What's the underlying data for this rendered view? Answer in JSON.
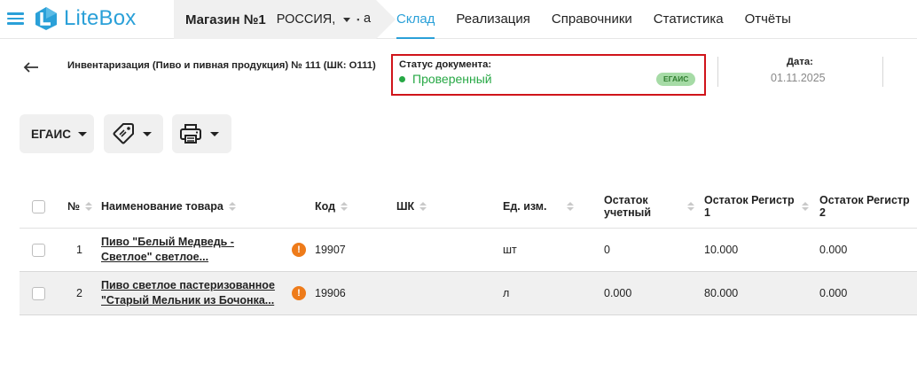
{
  "header": {
    "logo_text": "LiteBox",
    "store_name": "Магазин №1",
    "store_country": "РОССИЯ,",
    "store_tail": "а",
    "nav": [
      {
        "label": "Склад",
        "active": true
      },
      {
        "label": "Реализация",
        "active": false
      },
      {
        "label": "Справочники",
        "active": false
      },
      {
        "label": "Статистика",
        "active": false
      },
      {
        "label": "Отчёты",
        "active": false
      }
    ],
    "accent_color": "#2aa0d8"
  },
  "document": {
    "title": "Инвентаризация (Пиво и пивная продукция) № 111 (ШК: О111)",
    "status_label": "Статус документа:",
    "status_value": "Проверенный",
    "status_color": "#27a845",
    "status_badge": "ЕГАИС",
    "date_label": "Дата:",
    "date_value": "01.11.2025"
  },
  "toolbar": {
    "egais_label": "ЕГАИС",
    "tag_icon": "tag-icon",
    "print_icon": "printer-icon"
  },
  "table": {
    "columns": {
      "num": "№",
      "name": "Наименование товара",
      "code": "Код",
      "barcode": "ШК",
      "unit": "Ед. изм.",
      "stock": "Остаток учетный",
      "reg1": "Остаток Регистр 1",
      "reg2": "Остаток Регистр 2"
    },
    "rows": [
      {
        "num": "1",
        "name_line1": "Пиво \"Белый Медведь -",
        "name_line2": "Светлое\" светлое...",
        "code": "19907",
        "barcode": "",
        "unit": "шт",
        "stock": "0",
        "reg1": "10.000",
        "reg2": "0.000",
        "warning": true
      },
      {
        "num": "2",
        "name_line1": "Пиво светлое пастеризованное",
        "name_line2": "\"Старый Мельник из Бочонка...",
        "code": "19906",
        "barcode": "",
        "unit": "л",
        "stock": "0.000",
        "reg1": "80.000",
        "reg2": "0.000",
        "warning": true
      }
    ]
  }
}
